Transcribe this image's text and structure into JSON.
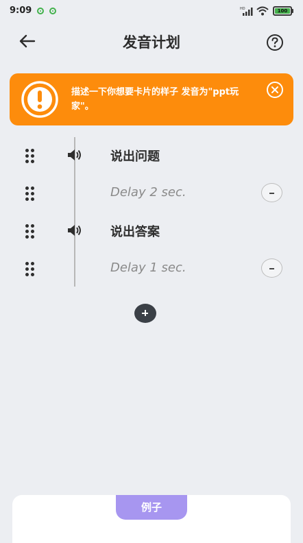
{
  "status_bar": {
    "time": "9:09",
    "battery": "100",
    "dot_color": "#42b14c"
  },
  "header": {
    "title": "发音计划",
    "back_icon": "arrow-left-icon",
    "help_icon": "question-circle-icon"
  },
  "notice": {
    "text": "描述一下你想要卡片的样子 发音为\"ppt玩家\"。",
    "icon": "exclamation-circle-icon",
    "close_icon": "close-circle-icon",
    "background": "#fd8c0c"
  },
  "steps": [
    {
      "type": "speak",
      "label": "说出问题",
      "icon": "speaker-icon"
    },
    {
      "type": "delay",
      "label": "Delay 2 sec.",
      "action_icon": "minus-icon"
    },
    {
      "type": "speak",
      "label": "说出答案",
      "icon": "speaker-icon"
    },
    {
      "type": "delay",
      "label": "Delay 1 sec.",
      "action_icon": "minus-icon"
    }
  ],
  "add_icon": "plus-icon",
  "example": {
    "tab_label": "例子",
    "accent": "#a796f0"
  }
}
